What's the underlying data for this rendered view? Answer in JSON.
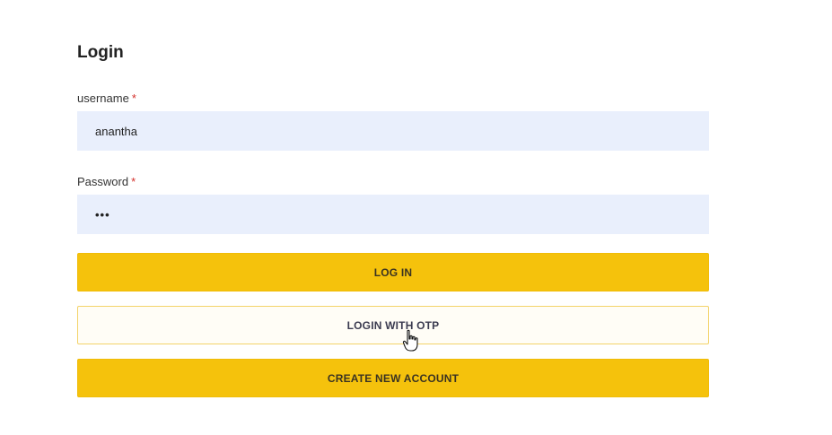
{
  "form": {
    "title": "Login",
    "username": {
      "label": "username",
      "required_mark": "*",
      "value": "anantha"
    },
    "password": {
      "label": "Password",
      "required_mark": "*",
      "value": "•••"
    },
    "buttons": {
      "login": "LOG IN",
      "login_otp": "LOGIN WITH OTP",
      "create_account": "CREATE NEW ACCOUNT"
    }
  },
  "colors": {
    "accent": "#f5c20c",
    "input_bg": "#e9effc",
    "required": "#d4302b"
  },
  "cursor_icon": "hand-pointer-icon"
}
